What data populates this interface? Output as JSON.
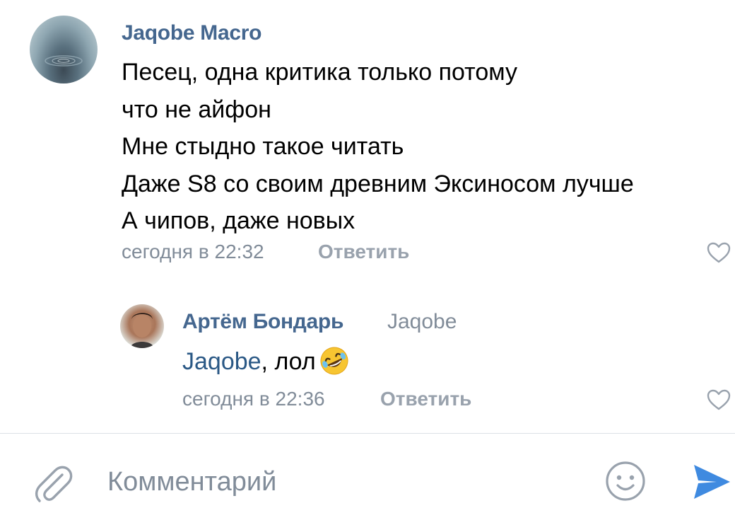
{
  "comments": [
    {
      "author": "Jaqobe Macro",
      "lines": [
        "Песец, одна критика только потому",
        "что не айфон",
        "Мне стыдно такое читать",
        "Даже S8 со своим древним Эксиносом лучше",
        "А чипов, даже новых"
      ],
      "time": "сегодня в 22:32",
      "reply_label": "Ответить"
    },
    {
      "author": "Артём Бондарь",
      "reply_to": "Jaqobe",
      "mention": "Jaqobe",
      "text": ", лол",
      "emoji": "rolling-on-floor-laughing",
      "time": "сегодня в 22:36",
      "reply_label": "Ответить"
    }
  ],
  "composer": {
    "placeholder": "Комментарий"
  },
  "icons": {
    "attach": "paperclip-icon",
    "emoji": "smile-icon",
    "send": "send-icon",
    "like": "heart-icon"
  },
  "colors": {
    "link": "#45678f",
    "secondary": "#818c99",
    "accent": "#3f8ae0"
  }
}
